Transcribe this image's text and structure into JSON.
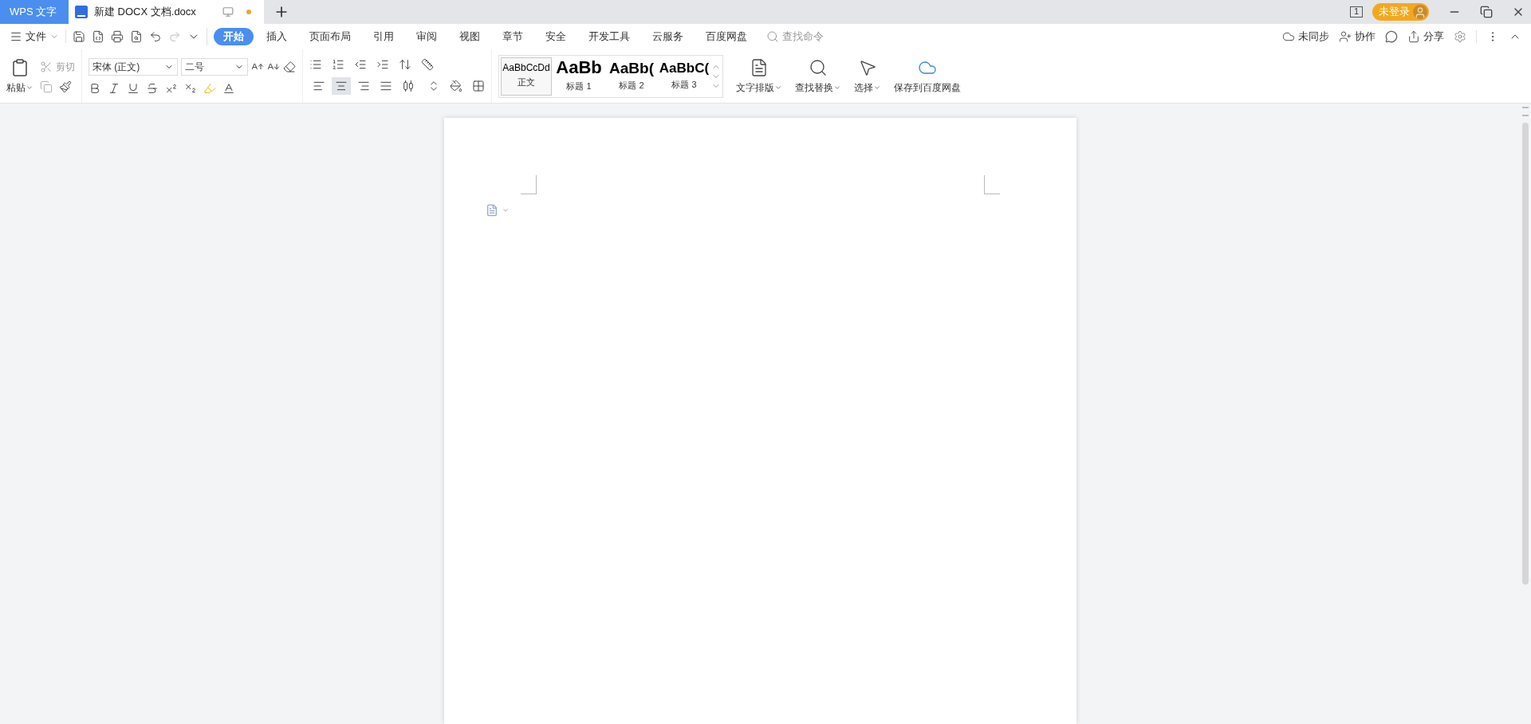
{
  "title_bar": {
    "app_tab": "WPS 文字",
    "document_tab": {
      "title": "新建 DOCX 文档.docx",
      "modified": true
    },
    "page_count": "1",
    "login": "未登录"
  },
  "menu": {
    "file": "文件",
    "tabs": [
      {
        "label": "开始",
        "selected": true
      },
      {
        "label": "插入",
        "selected": false
      },
      {
        "label": "页面布局",
        "selected": false
      },
      {
        "label": "引用",
        "selected": false
      },
      {
        "label": "审阅",
        "selected": false
      },
      {
        "label": "视图",
        "selected": false
      },
      {
        "label": "章节",
        "selected": false
      },
      {
        "label": "安全",
        "selected": false
      },
      {
        "label": "开发工具",
        "selected": false
      },
      {
        "label": "云服务",
        "selected": false
      },
      {
        "label": "百度网盘",
        "selected": false
      }
    ],
    "search": {
      "placeholder": "查找命令"
    },
    "actions": [
      "未同步",
      "协作",
      "分享"
    ]
  },
  "ribbon": {
    "paste": "粘贴",
    "cut": "剪切",
    "font": {
      "name": "宋体 (正文)",
      "size": "二号"
    },
    "alignment": [
      {
        "selected": false
      },
      {
        "selected": true
      },
      {
        "selected": false
      },
      {
        "selected": false
      },
      {
        "selected": false
      }
    ],
    "styles": [
      {
        "preview": "AaBbCcDd",
        "label": "正文",
        "kind": "normal",
        "selected": true
      },
      {
        "preview": "AaBb",
        "label": "标题 1",
        "kind": "h1",
        "selected": false
      },
      {
        "preview": "AaBb(",
        "label": "标题 2",
        "kind": "h2",
        "selected": false
      },
      {
        "preview": "AaBbC(",
        "label": "标题 3",
        "kind": "h3",
        "selected": false
      }
    ],
    "buttons": [
      {
        "label": "文字排版",
        "kind": "layout"
      },
      {
        "label": "查找替换",
        "kind": "find"
      },
      {
        "label": "选择",
        "kind": "select"
      },
      {
        "label": "保存到百度网盘",
        "kind": "cloud"
      }
    ]
  }
}
